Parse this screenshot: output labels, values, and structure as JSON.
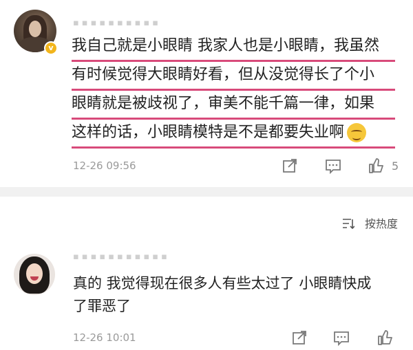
{
  "comment1": {
    "lines": [
      "我自己就是小眼睛 我家人也是小眼睛，我虽然",
      "有时候觉得大眼睛好看，但从没觉得长了个小",
      "眼睛就是被歧视了，审美不能千篇一律，如果",
      "这样的话，小眼睛模特是不是都要失业啊"
    ],
    "verified_badge": "v",
    "timestamp": "12-26 09:56",
    "like_count": "5",
    "icons": [
      "share-icon",
      "comment-icon",
      "like-icon",
      "emoji-sweat-icon"
    ]
  },
  "sort": {
    "label": "按热度"
  },
  "comment2": {
    "lines": [
      "真的 我觉得现在很多人有些太过了 小眼睛快成",
      "了罪恶了"
    ],
    "timestamp": "12-26 10:01",
    "icons": [
      "share-icon",
      "comment-icon",
      "like-icon"
    ]
  },
  "colors": {
    "underline": "#d84a7a",
    "badge": "#f2b51c",
    "divider": "#f1f1f1",
    "meta_text": "#9a9a9a"
  }
}
